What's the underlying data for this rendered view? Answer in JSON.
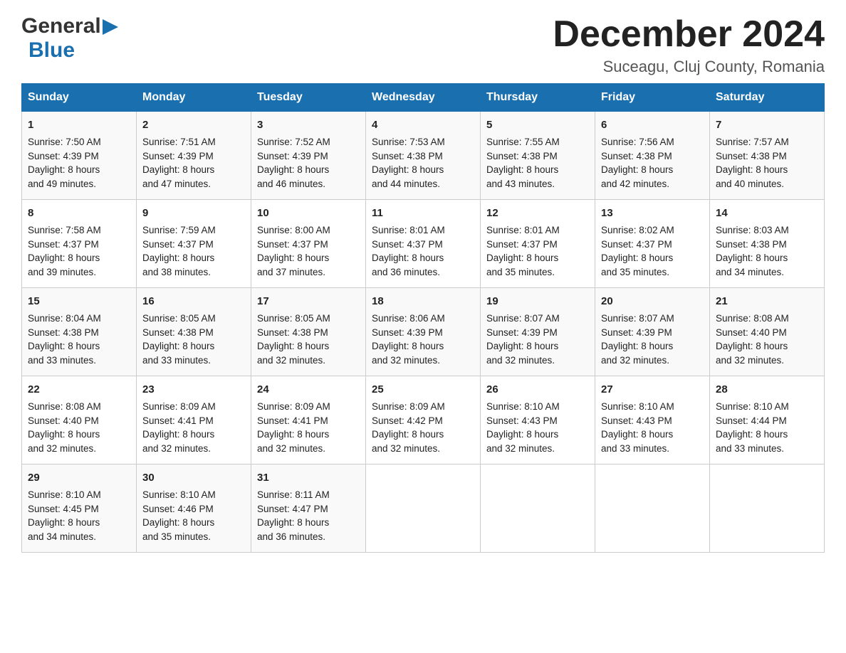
{
  "logo": {
    "general": "General",
    "blue": "Blue",
    "arrow": "▶"
  },
  "title": "December 2024",
  "subtitle": "Suceagu, Cluj County, Romania",
  "days": [
    "Sunday",
    "Monday",
    "Tuesday",
    "Wednesday",
    "Thursday",
    "Friday",
    "Saturday"
  ],
  "weeks": [
    [
      {
        "date": "1",
        "sunrise": "7:50 AM",
        "sunset": "4:39 PM",
        "daylight_hours": "8",
        "daylight_minutes": "49"
      },
      {
        "date": "2",
        "sunrise": "7:51 AM",
        "sunset": "4:39 PM",
        "daylight_hours": "8",
        "daylight_minutes": "47"
      },
      {
        "date": "3",
        "sunrise": "7:52 AM",
        "sunset": "4:39 PM",
        "daylight_hours": "8",
        "daylight_minutes": "46"
      },
      {
        "date": "4",
        "sunrise": "7:53 AM",
        "sunset": "4:38 PM",
        "daylight_hours": "8",
        "daylight_minutes": "44"
      },
      {
        "date": "5",
        "sunrise": "7:55 AM",
        "sunset": "4:38 PM",
        "daylight_hours": "8",
        "daylight_minutes": "43"
      },
      {
        "date": "6",
        "sunrise": "7:56 AM",
        "sunset": "4:38 PM",
        "daylight_hours": "8",
        "daylight_minutes": "42"
      },
      {
        "date": "7",
        "sunrise": "7:57 AM",
        "sunset": "4:38 PM",
        "daylight_hours": "8",
        "daylight_minutes": "40"
      }
    ],
    [
      {
        "date": "8",
        "sunrise": "7:58 AM",
        "sunset": "4:37 PM",
        "daylight_hours": "8",
        "daylight_minutes": "39"
      },
      {
        "date": "9",
        "sunrise": "7:59 AM",
        "sunset": "4:37 PM",
        "daylight_hours": "8",
        "daylight_minutes": "38"
      },
      {
        "date": "10",
        "sunrise": "8:00 AM",
        "sunset": "4:37 PM",
        "daylight_hours": "8",
        "daylight_minutes": "37"
      },
      {
        "date": "11",
        "sunrise": "8:01 AM",
        "sunset": "4:37 PM",
        "daylight_hours": "8",
        "daylight_minutes": "36"
      },
      {
        "date": "12",
        "sunrise": "8:01 AM",
        "sunset": "4:37 PM",
        "daylight_hours": "8",
        "daylight_minutes": "35"
      },
      {
        "date": "13",
        "sunrise": "8:02 AM",
        "sunset": "4:37 PM",
        "daylight_hours": "8",
        "daylight_minutes": "35"
      },
      {
        "date": "14",
        "sunrise": "8:03 AM",
        "sunset": "4:38 PM",
        "daylight_hours": "8",
        "daylight_minutes": "34"
      }
    ],
    [
      {
        "date": "15",
        "sunrise": "8:04 AM",
        "sunset": "4:38 PM",
        "daylight_hours": "8",
        "daylight_minutes": "33"
      },
      {
        "date": "16",
        "sunrise": "8:05 AM",
        "sunset": "4:38 PM",
        "daylight_hours": "8",
        "daylight_minutes": "33"
      },
      {
        "date": "17",
        "sunrise": "8:05 AM",
        "sunset": "4:38 PM",
        "daylight_hours": "8",
        "daylight_minutes": "32"
      },
      {
        "date": "18",
        "sunrise": "8:06 AM",
        "sunset": "4:39 PM",
        "daylight_hours": "8",
        "daylight_minutes": "32"
      },
      {
        "date": "19",
        "sunrise": "8:07 AM",
        "sunset": "4:39 PM",
        "daylight_hours": "8",
        "daylight_minutes": "32"
      },
      {
        "date": "20",
        "sunrise": "8:07 AM",
        "sunset": "4:39 PM",
        "daylight_hours": "8",
        "daylight_minutes": "32"
      },
      {
        "date": "21",
        "sunrise": "8:08 AM",
        "sunset": "4:40 PM",
        "daylight_hours": "8",
        "daylight_minutes": "32"
      }
    ],
    [
      {
        "date": "22",
        "sunrise": "8:08 AM",
        "sunset": "4:40 PM",
        "daylight_hours": "8",
        "daylight_minutes": "32"
      },
      {
        "date": "23",
        "sunrise": "8:09 AM",
        "sunset": "4:41 PM",
        "daylight_hours": "8",
        "daylight_minutes": "32"
      },
      {
        "date": "24",
        "sunrise": "8:09 AM",
        "sunset": "4:41 PM",
        "daylight_hours": "8",
        "daylight_minutes": "32"
      },
      {
        "date": "25",
        "sunrise": "8:09 AM",
        "sunset": "4:42 PM",
        "daylight_hours": "8",
        "daylight_minutes": "32"
      },
      {
        "date": "26",
        "sunrise": "8:10 AM",
        "sunset": "4:43 PM",
        "daylight_hours": "8",
        "daylight_minutes": "32"
      },
      {
        "date": "27",
        "sunrise": "8:10 AM",
        "sunset": "4:43 PM",
        "daylight_hours": "8",
        "daylight_minutes": "33"
      },
      {
        "date": "28",
        "sunrise": "8:10 AM",
        "sunset": "4:44 PM",
        "daylight_hours": "8",
        "daylight_minutes": "33"
      }
    ],
    [
      {
        "date": "29",
        "sunrise": "8:10 AM",
        "sunset": "4:45 PM",
        "daylight_hours": "8",
        "daylight_minutes": "34"
      },
      {
        "date": "30",
        "sunrise": "8:10 AM",
        "sunset": "4:46 PM",
        "daylight_hours": "8",
        "daylight_minutes": "35"
      },
      {
        "date": "31",
        "sunrise": "8:11 AM",
        "sunset": "4:47 PM",
        "daylight_hours": "8",
        "daylight_minutes": "36"
      },
      null,
      null,
      null,
      null
    ]
  ],
  "labels": {
    "sunrise": "Sunrise:",
    "sunset": "Sunset:",
    "daylight": "Daylight: 8 hours"
  },
  "colors": {
    "header_bg": "#1a6faf",
    "accent": "#1a6faf"
  }
}
